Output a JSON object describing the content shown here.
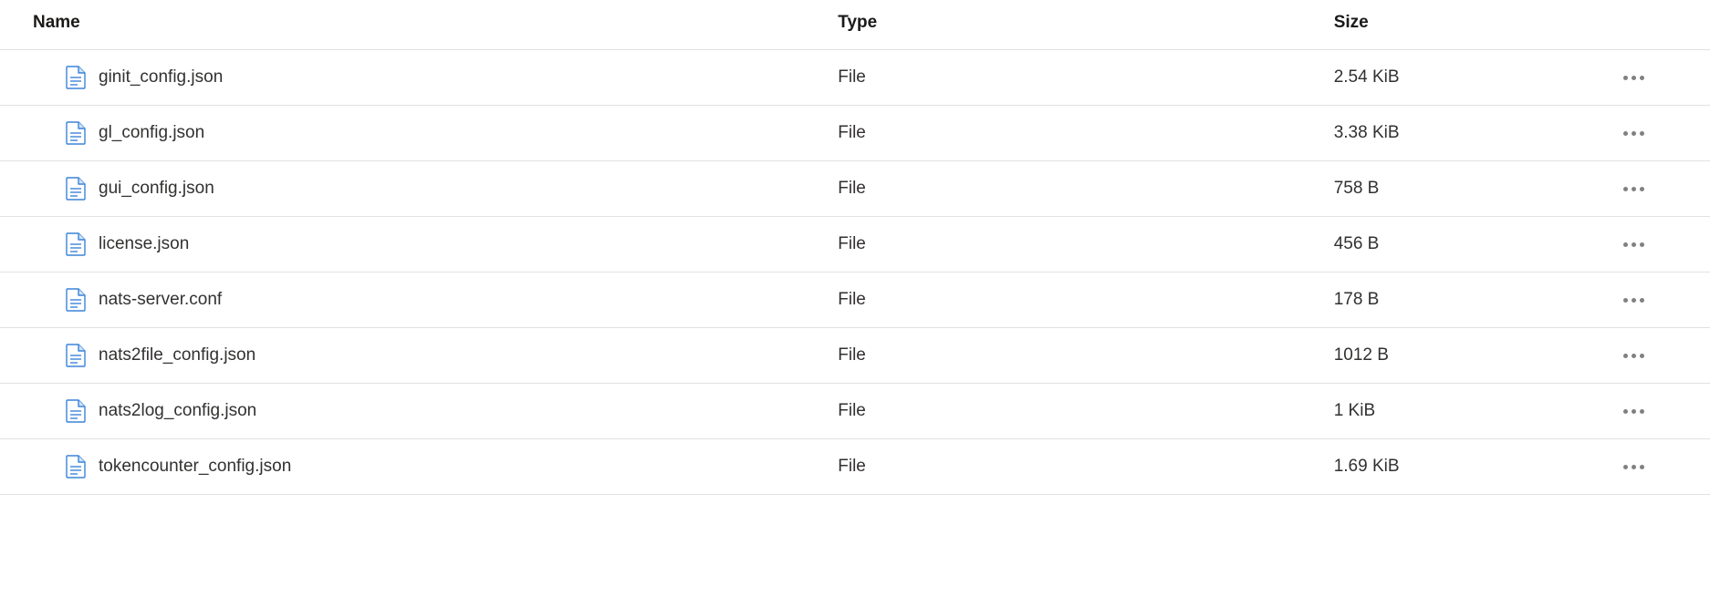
{
  "table": {
    "columns": {
      "name": "Name",
      "type": "Type",
      "size": "Size"
    },
    "rows": [
      {
        "name": "ginit_config.json",
        "type": "File",
        "size": "2.54 KiB"
      },
      {
        "name": "gl_config.json",
        "type": "File",
        "size": "3.38 KiB"
      },
      {
        "name": "gui_config.json",
        "type": "File",
        "size": "758 B"
      },
      {
        "name": "license.json",
        "type": "File",
        "size": "456 B"
      },
      {
        "name": "nats-server.conf",
        "type": "File",
        "size": "178 B"
      },
      {
        "name": "nats2file_config.json",
        "type": "File",
        "size": "1012 B"
      },
      {
        "name": "nats2log_config.json",
        "type": "File",
        "size": "1 KiB"
      },
      {
        "name": "tokencounter_config.json",
        "type": "File",
        "size": "1.69 KiB"
      }
    ]
  }
}
